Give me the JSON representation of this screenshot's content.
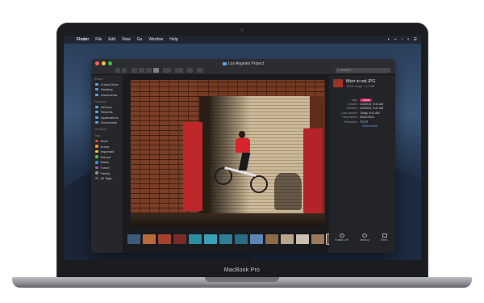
{
  "device": {
    "label": "MacBook Pro"
  },
  "menubar": {
    "apple": "",
    "items": [
      "Finder",
      "File",
      "Edit",
      "View",
      "Go",
      "Window",
      "Help"
    ],
    "status": [
      "◐",
      "⌁",
      "◔",
      "⌕",
      "☰"
    ]
  },
  "window": {
    "title": "Los Angeles Project",
    "search_placeholder": "Search"
  },
  "sidebar": {
    "sections": [
      {
        "header": "iCloud",
        "items": [
          {
            "label": "iCloud Drive"
          },
          {
            "label": "Desktop"
          },
          {
            "label": "Documents"
          }
        ]
      },
      {
        "header": "Favorites",
        "items": [
          {
            "label": "AirDrop"
          },
          {
            "label": "Recents"
          },
          {
            "label": "Applications"
          },
          {
            "label": "Downloads"
          }
        ]
      },
      {
        "header": "Locations",
        "items": []
      },
      {
        "header": "Tags",
        "items": [
          {
            "label": "Work",
            "color": "#e0453a"
          },
          {
            "label": "Home",
            "color": "#f39a2b"
          },
          {
            "label": "Important",
            "color": "#f2c83b"
          },
          {
            "label": "School",
            "color": "#56c14d"
          },
          {
            "label": "Music",
            "color": "#3a8ee6"
          },
          {
            "label": "Travel",
            "color": "#a35bd3"
          },
          {
            "label": "Family",
            "color": "#8f9196"
          },
          {
            "label": "All Tags...",
            "color": "#5e6066"
          }
        ]
      }
    ]
  },
  "filmstrip": {
    "thumbs": [
      {
        "color": "#3d5a7a"
      },
      {
        "color": "#b86a3a"
      },
      {
        "color": "#a84030"
      },
      {
        "color": "#7d2a2a"
      },
      {
        "color": "#2a8fa3"
      },
      {
        "color": "#3aa0b8"
      },
      {
        "color": "#2f7d96"
      },
      {
        "color": "#2a6c84"
      },
      {
        "color": "#5c86b8"
      },
      {
        "color": "#8c6a4a"
      },
      {
        "color": "#b8a58c"
      },
      {
        "color": "#c9c0b0"
      },
      {
        "color": "#9a7a5a"
      },
      {
        "color": "#6a4a3a",
        "selected": true
      }
    ]
  },
  "inspector": {
    "name": "Biker in red.JPG",
    "subtitle": "JPEG image – 3.7 MB",
    "rows": [
      {
        "key": "Tags",
        "value": "Travel",
        "tag": true
      },
      {
        "key": "Created",
        "value": "10/25/15, 9:41 AM"
      },
      {
        "key": "Modified",
        "value": "10/25/15, 9:41 AM"
      },
      {
        "key": "Last opened",
        "value": "Today, 9:41 AM"
      },
      {
        "key": "Dimensions",
        "value": "4032×3024"
      },
      {
        "key": "Resolution",
        "value": "72×72"
      }
    ],
    "show_more": "Show More",
    "actions": [
      {
        "label": "Rotate Left"
      },
      {
        "label": "Markup"
      },
      {
        "label": "More..."
      }
    ]
  }
}
